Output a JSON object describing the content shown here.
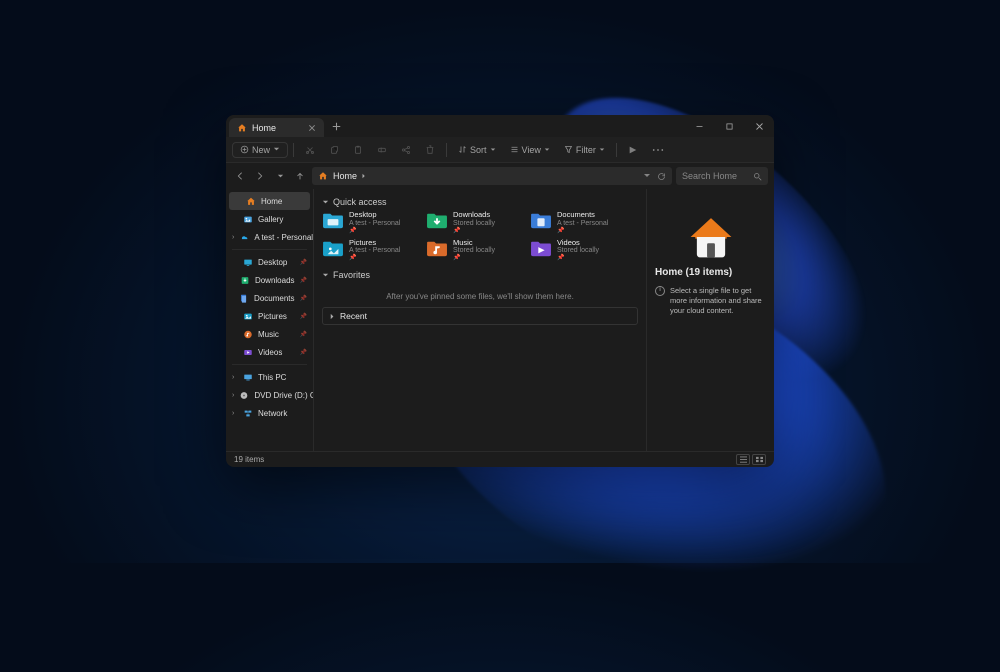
{
  "tab": {
    "title": "Home"
  },
  "toolbar": {
    "new": "New",
    "sort": "Sort",
    "view": "View",
    "filter": "Filter"
  },
  "breadcrumb": {
    "root": "Home"
  },
  "search": {
    "placeholder": "Search Home"
  },
  "sidebar": {
    "items": [
      {
        "label": "Home",
        "icon": "home",
        "active": true
      },
      {
        "label": "Gallery",
        "icon": "gallery"
      },
      {
        "label": "A test - Personal",
        "icon": "onedrive",
        "expandable": true
      }
    ],
    "pinned": [
      {
        "label": "Desktop",
        "icon": "desktop"
      },
      {
        "label": "Downloads",
        "icon": "downloads"
      },
      {
        "label": "Documents",
        "icon": "documents"
      },
      {
        "label": "Pictures",
        "icon": "pictures"
      },
      {
        "label": "Music",
        "icon": "music"
      },
      {
        "label": "Videos",
        "icon": "videos"
      }
    ],
    "drives": [
      {
        "label": "This PC",
        "icon": "pc",
        "expandable": true
      },
      {
        "label": "DVD Drive (D:) CCC",
        "icon": "dvd",
        "expandable": true
      },
      {
        "label": "Network",
        "icon": "network",
        "expandable": true
      }
    ]
  },
  "sections": {
    "quick": "Quick access",
    "favorites": "Favorites",
    "recent": "Recent"
  },
  "quick_items": [
    {
      "name": "Desktop",
      "sub": "A test - Personal",
      "color": "#2aa7d4"
    },
    {
      "name": "Downloads",
      "sub": "Stored locally",
      "color": "#1fae6f"
    },
    {
      "name": "Documents",
      "sub": "A test - Personal",
      "color": "#3b7dd8"
    },
    {
      "name": "Pictures",
      "sub": "A test - Personal",
      "color": "#1aa0c9"
    },
    {
      "name": "Music",
      "sub": "Stored locally",
      "color": "#d96b2b"
    },
    {
      "name": "Videos",
      "sub": "Stored locally",
      "color": "#7c4dd1"
    }
  ],
  "favorites_empty": "After you've pinned some files, we'll show them here.",
  "details": {
    "title": "Home (19 items)",
    "hint": "Select a single file to get more information and share your cloud content."
  },
  "status": {
    "count": "19 items"
  }
}
